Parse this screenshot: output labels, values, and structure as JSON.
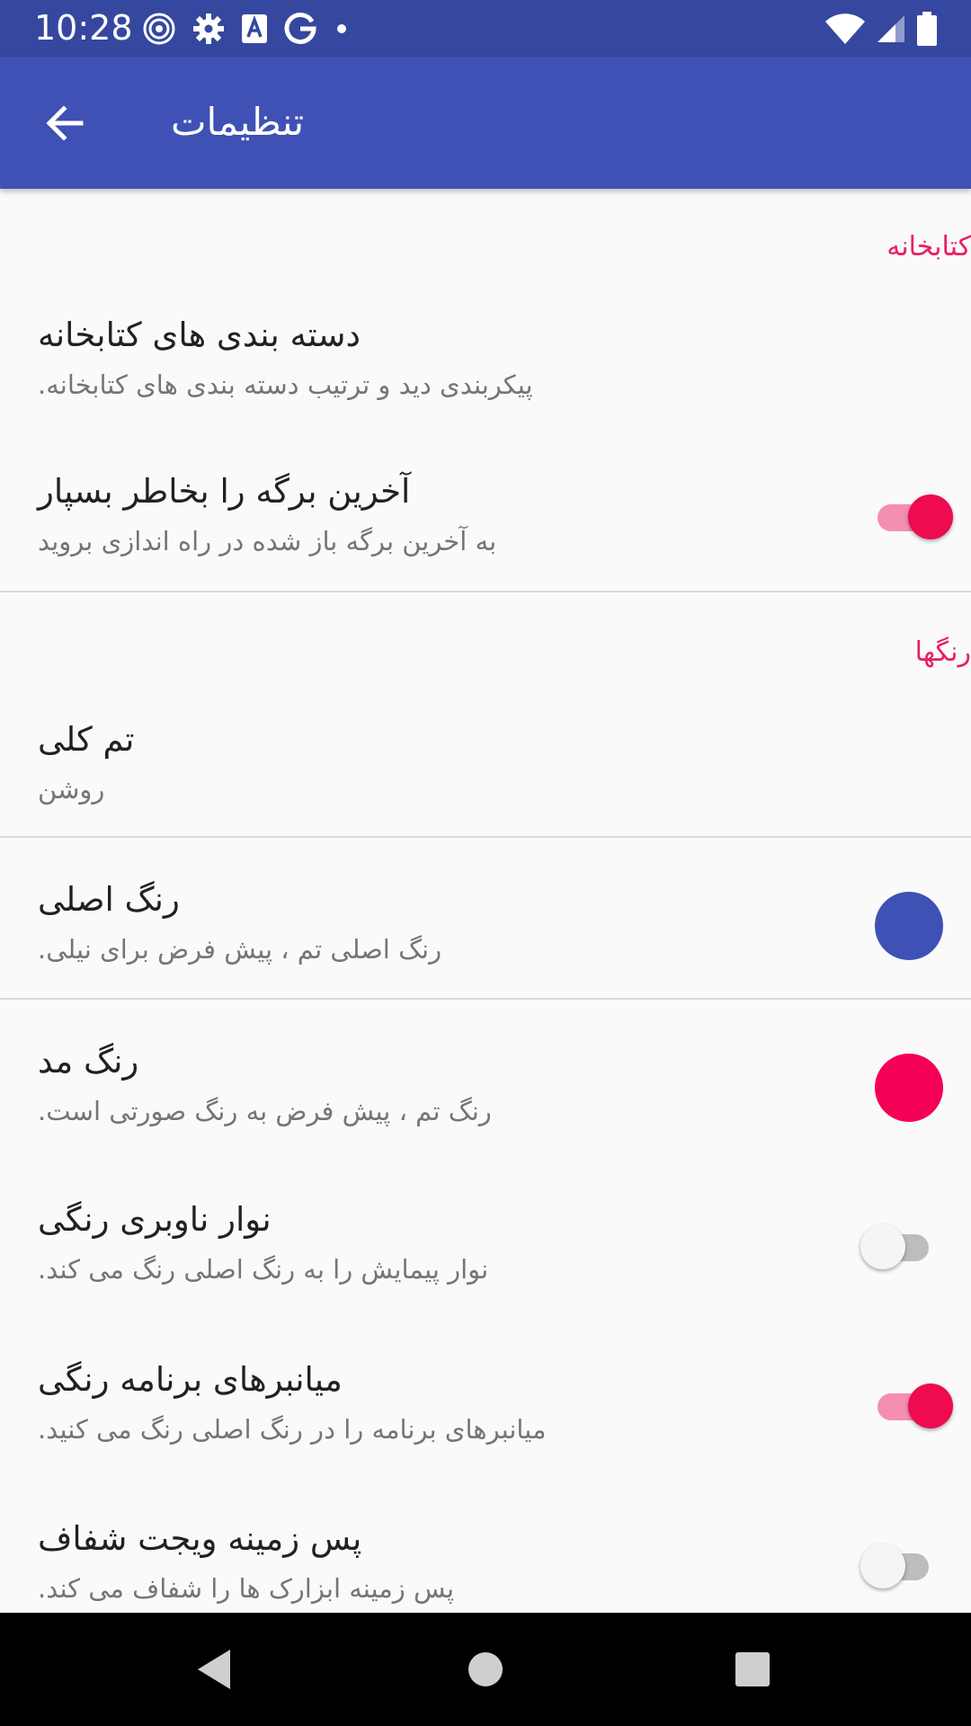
{
  "status_bar": {
    "time": "10:28",
    "left_icons": [
      "target-icon",
      "gear-icon",
      "font-a-icon",
      "google-g-icon",
      "dot-icon"
    ],
    "right_icons": [
      "wifi-icon",
      "signal-icon",
      "battery-icon"
    ]
  },
  "app_bar": {
    "title": "تنظیمات",
    "back_icon": "arrow-back-icon"
  },
  "sections": {
    "library": {
      "header": "كتابخانه",
      "items": [
        {
          "title": "دسته بندی های کتابخانه",
          "summary": "پیکربندی دید و ترتیب دسته بندی های کتابخانه."
        },
        {
          "title": "آخرین برگه را بخاطر بسپار",
          "summary": "به آخرین برگه باز شده در راه اندازی بروید",
          "switch_on": true
        }
      ]
    },
    "colors": {
      "header": "رنگها",
      "items": [
        {
          "title": "تم کلی",
          "summary": "روشن"
        },
        {
          "title": "رنگ اصلی",
          "summary": "رنگ اصلی تم ، پیش فرض برای نیلی.",
          "swatch_color": "#3F51B5"
        },
        {
          "title": "رنگ مد",
          "summary": "رنگ تم ، پیش فرض به رنگ صورتی است.",
          "swatch_color": "#F50057"
        },
        {
          "title": "نوار ناوبری رنگی",
          "summary": "نوار پیمایش را به رنگ اصلی رنگ می کند.",
          "switch_on": false
        },
        {
          "title": "میانبرهای برنامه رنگی",
          "summary": "میانبرهای برنامه را در رنگ اصلی رنگ می کنید.",
          "switch_on": true
        },
        {
          "title": "پس زمینه ویجت شفاف",
          "summary": "پس زمینه ابزارک ها را شفاف می کند.",
          "switch_on": false
        }
      ]
    }
  },
  "colors": {
    "primary": "#3F51B5",
    "status_bar": "#3647A0",
    "accent": "#E91E63",
    "switch_thumb_on": "#EE0B4F"
  },
  "nav_bar": {
    "icons": [
      "back-triangle-icon",
      "home-circle-icon",
      "recents-square-icon"
    ]
  }
}
